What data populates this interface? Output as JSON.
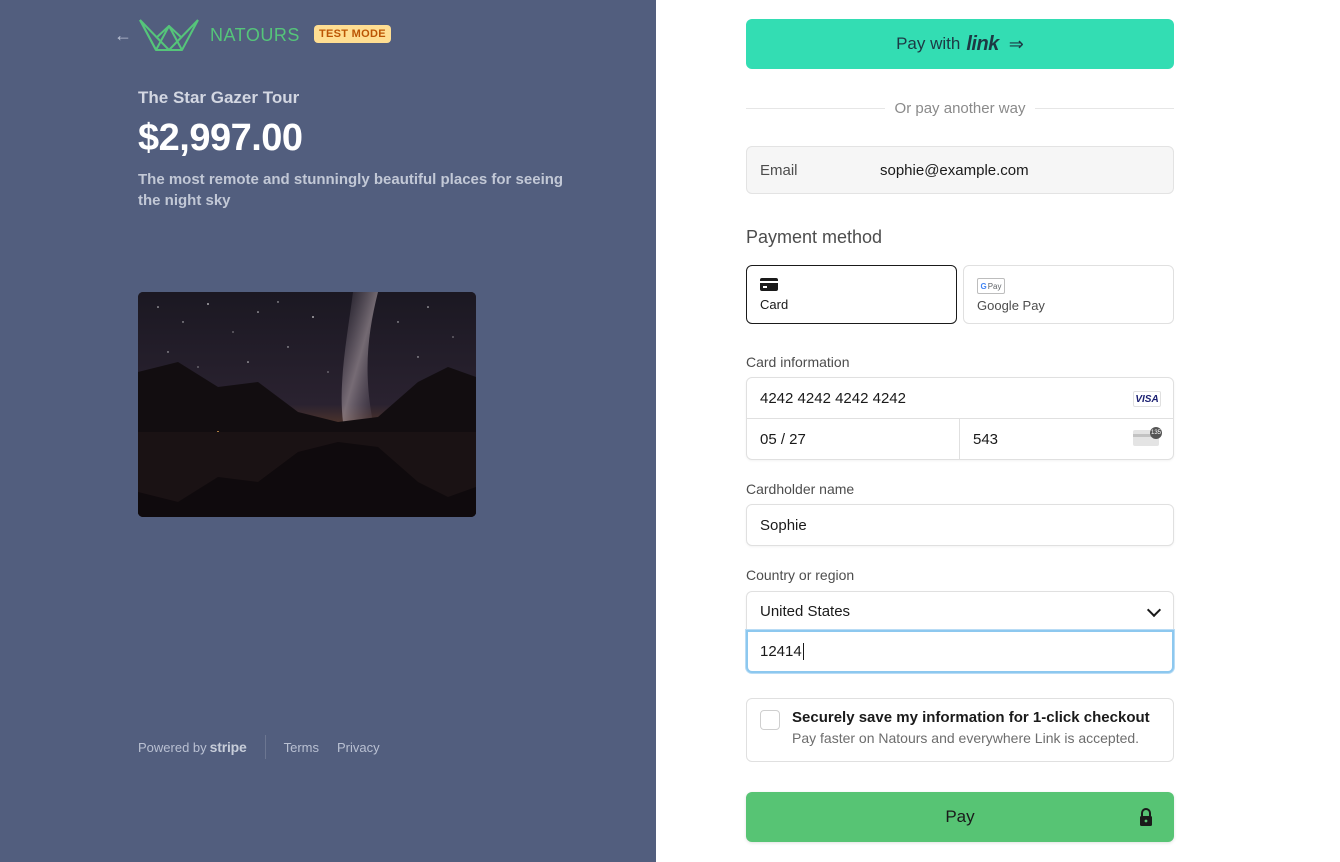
{
  "merchant": {
    "brand_name": "NATOURS",
    "test_badge": "TEST MODE",
    "brand_color": "#55c57a",
    "panel_color": "#525e7e"
  },
  "product": {
    "name": "The Star Gazer Tour",
    "price": "$2,997.00",
    "description": "The most remote and stunningly beautiful places for seeing the night sky"
  },
  "footer": {
    "powered_by": "Powered by",
    "stripe_word": "stripe",
    "terms": "Terms",
    "privacy": "Privacy"
  },
  "checkout": {
    "link_button": {
      "prefix": "Pay with",
      "link_word": "link",
      "color": "#33ddb3"
    },
    "divider_text": "Or pay another way",
    "email": {
      "label": "Email",
      "value": "sophie@example.com"
    },
    "payment_method_title": "Payment method",
    "payment_tabs": [
      {
        "label": "Card",
        "icon": "card-icon",
        "selected": true
      },
      {
        "label": "Google Pay",
        "icon": "google-pay-icon",
        "selected": false
      }
    ],
    "card_info_label": "Card information",
    "card_number": "4242 4242 4242 4242",
    "card_brand": "VISA",
    "expiry": "05 / 27",
    "cvc": "543",
    "cvc_icon_text": "135",
    "cardholder_label": "Cardholder name",
    "cardholder_value": "Sophie",
    "country_label": "Country or region",
    "country_value": "United States",
    "zip_value": "12414",
    "save_info": {
      "title": "Securely save my information for 1-click checkout",
      "subtitle": "Pay faster on Natours and everywhere Link is accepted.",
      "checked": false
    },
    "pay_button": {
      "label": "Pay",
      "color": "#57c474"
    }
  }
}
